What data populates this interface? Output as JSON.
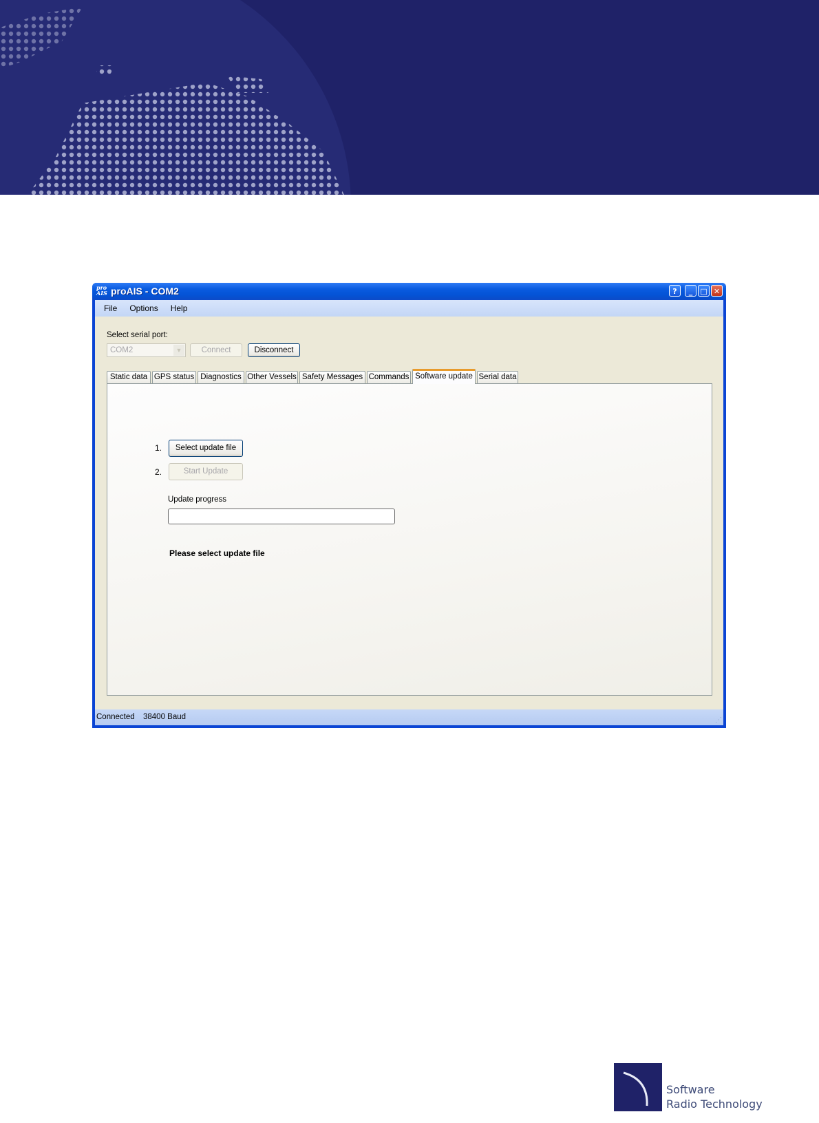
{
  "window": {
    "logo_top": "pro",
    "logo_bottom": "AIS",
    "title": "proAIS - COM2",
    "buttons": {
      "help": "?",
      "minimize": "_",
      "maximize": "□",
      "close": "✕"
    }
  },
  "menu": [
    "File",
    "Options",
    "Help"
  ],
  "connection": {
    "label": "Select serial port:",
    "port_value": "COM2",
    "connect_label": "Connect",
    "disconnect_label": "Disconnect"
  },
  "tabs": [
    {
      "label": "Static data"
    },
    {
      "label": "GPS status"
    },
    {
      "label": "Diagnostics"
    },
    {
      "label": "Other Vessels"
    },
    {
      "label": "Safety Messages"
    },
    {
      "label": "Commands"
    },
    {
      "label": "Software update",
      "active": true
    },
    {
      "label": "Serial data"
    }
  ],
  "update": {
    "step1": "1.",
    "step2": "2.",
    "select_file_label": "Select update file",
    "start_update_label": "Start Update",
    "progress_label": "Update progress",
    "progress": 0,
    "status_message": "Please select update file"
  },
  "statusbar": {
    "connection": "Connected",
    "baud": "38400 Baud"
  },
  "footer_logo": {
    "line1": "Software",
    "line2": "Radio Technology"
  },
  "colors": {
    "banner": "#1f2268",
    "window_frame": "#0a44d4",
    "active_tab_accent": "#e89b2c"
  }
}
